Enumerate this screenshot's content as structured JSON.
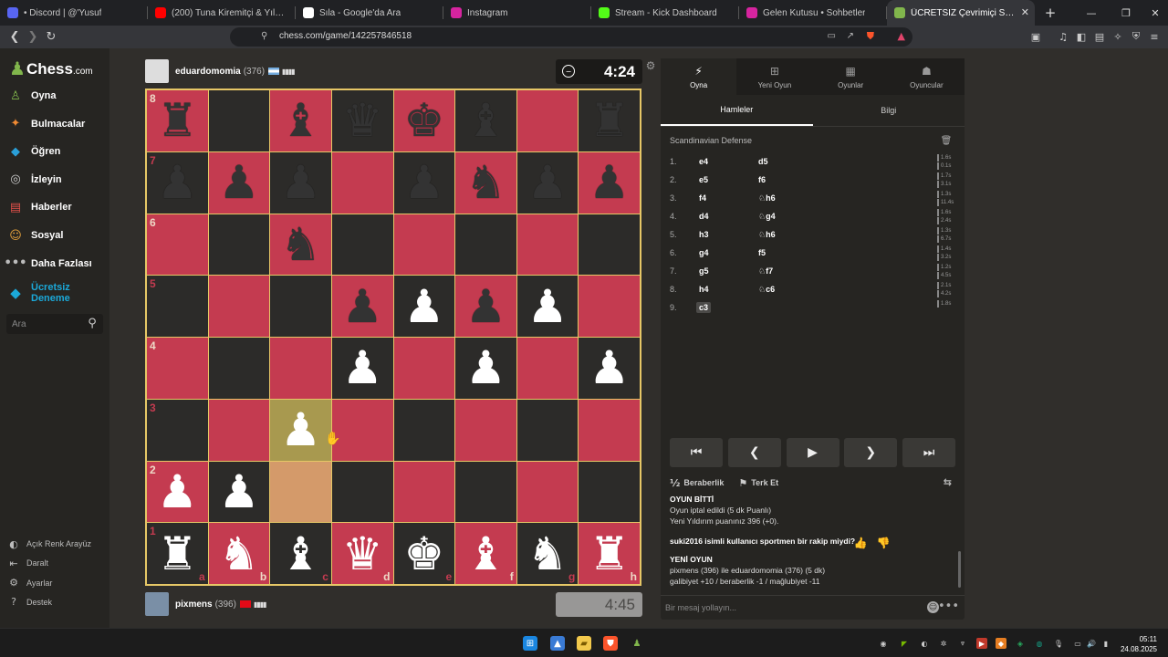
{
  "browser": {
    "tabs": [
      {
        "title": "• Discord | @'Yusuf",
        "fav_color": "#5865f2"
      },
      {
        "title": "(200) Tuna Kiremitçi & Yıldız Tilbe",
        "fav_color": "#ff0000"
      },
      {
        "title": "Sıla - Google'da Ara",
        "fav_color": "#ffffff"
      },
      {
        "title": "Instagram",
        "fav_color": "#d6249f"
      },
      {
        "title": "Stream - Kick Dashboard",
        "fav_color": "#53fc18"
      },
      {
        "title": "Gelen Kutusu • Sohbetler",
        "fav_color": "#d6249f"
      },
      {
        "title": "ÜCRETSİZ Çevrimiçi Satranç (",
        "fav_color": "#81b64c"
      }
    ],
    "new_tab": "+",
    "url": "chess.com/game/142257846518"
  },
  "sidebar": {
    "logo_main": "Chess",
    "logo_suffix": ".com",
    "items": [
      {
        "label": "Oyna",
        "icon": "♙",
        "color": "#81b64c"
      },
      {
        "label": "Bulmacalar",
        "icon": "✦",
        "color": "#f08a33"
      },
      {
        "label": "Öğren",
        "icon": "◆",
        "color": "#2a9fd8"
      },
      {
        "label": "İzleyin",
        "icon": "◎",
        "color": "#cccccc"
      },
      {
        "label": "Haberler",
        "icon": "▤",
        "color": "#e0504a"
      },
      {
        "label": "Sosyal",
        "icon": "☺",
        "color": "#e6a23c"
      },
      {
        "label": "Daha Fazlası",
        "icon": "•••",
        "color": "#bbbbbb"
      }
    ],
    "premium_line1": "Ücretsiz",
    "premium_line2": "Deneme",
    "search_placeholder": "Ara",
    "bottom": [
      {
        "label": "Açık Renk Arayüz",
        "icon": "◐"
      },
      {
        "label": "Daralt",
        "icon": "⇤"
      },
      {
        "label": "Ayarlar",
        "icon": "⚙"
      },
      {
        "label": "Destek",
        "icon": "?"
      }
    ]
  },
  "top_player": {
    "name": "eduardomomia",
    "rating": "(376)",
    "clock": "4:24",
    "flag_color": "#74acdf"
  },
  "bottom_player": {
    "name": "pixmens",
    "rating": "(396)",
    "clock": "4:45",
    "flag_color": "#e30a17"
  },
  "board": {
    "ranks": [
      "8",
      "7",
      "6",
      "5",
      "4",
      "3",
      "2",
      "1"
    ],
    "files": [
      "a",
      "b",
      "c",
      "d",
      "e",
      "f",
      "g",
      "h"
    ],
    "position": [
      [
        "br",
        "",
        "bb",
        "bq",
        "bk",
        "bb",
        "",
        "br"
      ],
      [
        "bp",
        "bp",
        "bp",
        "",
        "bp",
        "bn",
        "bp",
        "bp"
      ],
      [
        "",
        "",
        "bn",
        "",
        "",
        "",
        "",
        ""
      ],
      [
        "",
        "",
        "",
        "bp",
        "wp",
        "bp",
        "wp",
        ""
      ],
      [
        "",
        "",
        "",
        "wp",
        "",
        "wp",
        "",
        "wp"
      ],
      [
        "",
        "",
        "wp",
        "",
        "",
        "",
        "",
        ""
      ],
      [
        "wp",
        "wp",
        "",
        "",
        "",
        "",
        "",
        ""
      ],
      [
        "wr",
        "wn",
        "wb",
        "wq",
        "wk",
        "wb",
        "wn",
        "wr"
      ]
    ],
    "highlight_from": "c2",
    "highlight_to": "c3"
  },
  "panel": {
    "tabs": [
      {
        "label": "Oyna",
        "icon": "⚡"
      },
      {
        "label": "Yeni Oyun",
        "icon": "⊞"
      },
      {
        "label": "Oyunlar",
        "icon": "▦"
      },
      {
        "label": "Oyuncular",
        "icon": "☗"
      }
    ],
    "subtabs": [
      "Hamleler",
      "Bilgi"
    ],
    "opening": "Scandinavian Defense",
    "moves": [
      {
        "n": "1.",
        "w": "e4",
        "b": "d5",
        "tw": "1.6s",
        "tb": "0.1s"
      },
      {
        "n": "2.",
        "w": "e5",
        "b": "f6",
        "tw": "1.7s",
        "tb": "3.1s"
      },
      {
        "n": "3.",
        "w": "f4",
        "b": "♘h6",
        "tw": "1.3s",
        "tb": "11.4s"
      },
      {
        "n": "4.",
        "w": "d4",
        "b": "♘g4",
        "tw": "1.6s",
        "tb": "2.4s"
      },
      {
        "n": "5.",
        "w": "h3",
        "b": "♘h6",
        "tw": "1.3s",
        "tb": "6.7s"
      },
      {
        "n": "6.",
        "w": "g4",
        "b": "f5",
        "tw": "1.4s",
        "tb": "3.2s"
      },
      {
        "n": "7.",
        "w": "g5",
        "b": "♘f7",
        "tw": "1.2s",
        "tb": "4.5s"
      },
      {
        "n": "8.",
        "w": "h4",
        "b": "♘c6",
        "tw": "2.1s",
        "tb": "4.2s"
      },
      {
        "n": "9.",
        "w": "c3",
        "b": "",
        "tw": "1.8s",
        "tb": ""
      }
    ],
    "draw_label": "Beraberlik",
    "resign_label": "Terk Et",
    "chat": {
      "game_over": "OYUN BİTTİ",
      "aborted": "Oyun iptal edildi (5 dk Puanlı)",
      "new_rating": "Yeni Yıldırım puanınız 396 (+0).",
      "question": "suki2016 isimli kullanıcı sportmen bir rakip miydi?",
      "new_game": "YENİ OYUN",
      "match": "pixmens (396) ile eduardomomia (376) (5 dk)",
      "record": "galibiyet +10 / beraberlik -1 / mağlubiyet -11",
      "placeholder": "Bir mesaj yollayın..."
    }
  },
  "taskbar": {
    "time": "05:11",
    "date": "24.08.2025"
  }
}
